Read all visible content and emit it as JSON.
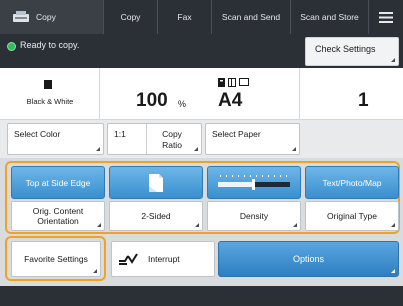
{
  "tabs": {
    "home": "Copy",
    "copy": "Copy",
    "fax": "Fax",
    "scan_and_send": "Scan and Send",
    "scan_and_store": "Scan and Store",
    "menu_icon": "hamburger-menu-icon"
  },
  "status": {
    "message": "Ready to copy.",
    "indicator_color": "#2fbf5b",
    "check_settings": "Check Settings"
  },
  "display": {
    "color_mode": "Black & White",
    "ratio_value": "100",
    "ratio_unit": "%",
    "paper_size": "A4",
    "copies": "1"
  },
  "quick_buttons": {
    "select_color": "Select Color",
    "ratio_one": "1:1",
    "copy_ratio": "Copy Ratio",
    "select_paper": "Select Paper"
  },
  "settings": {
    "orientation_value": "Top at Side Edge",
    "orientation_label": "Orig. Content Orientation",
    "sided_label": "2-Sided",
    "density_label": "Density",
    "original_value": "Text/Photo/Map",
    "original_label": "Original Type"
  },
  "bottom": {
    "favorite": "Favorite Settings",
    "interrupt": "Interrupt",
    "options": "Options"
  },
  "colors": {
    "accent_orange": "#f0a321",
    "button_blue": "#3a8fcf",
    "header_dark": "#2b2f36"
  }
}
